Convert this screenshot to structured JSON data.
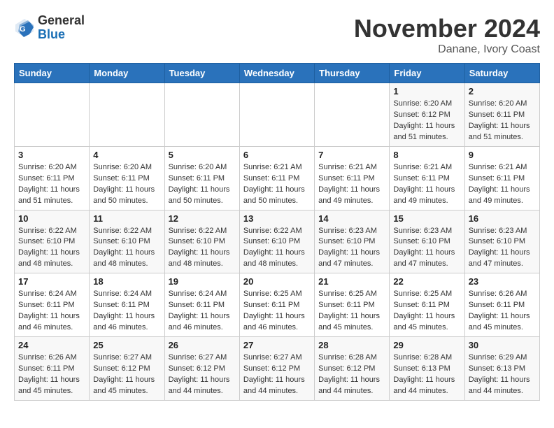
{
  "header": {
    "logo_line1": "General",
    "logo_line2": "Blue",
    "month": "November 2024",
    "location": "Danane, Ivory Coast"
  },
  "weekdays": [
    "Sunday",
    "Monday",
    "Tuesday",
    "Wednesday",
    "Thursday",
    "Friday",
    "Saturday"
  ],
  "weeks": [
    [
      {
        "day": "",
        "info": ""
      },
      {
        "day": "",
        "info": ""
      },
      {
        "day": "",
        "info": ""
      },
      {
        "day": "",
        "info": ""
      },
      {
        "day": "",
        "info": ""
      },
      {
        "day": "1",
        "info": "Sunrise: 6:20 AM\nSunset: 6:12 PM\nDaylight: 11 hours\nand 51 minutes."
      },
      {
        "day": "2",
        "info": "Sunrise: 6:20 AM\nSunset: 6:11 PM\nDaylight: 11 hours\nand 51 minutes."
      }
    ],
    [
      {
        "day": "3",
        "info": "Sunrise: 6:20 AM\nSunset: 6:11 PM\nDaylight: 11 hours\nand 51 minutes."
      },
      {
        "day": "4",
        "info": "Sunrise: 6:20 AM\nSunset: 6:11 PM\nDaylight: 11 hours\nand 50 minutes."
      },
      {
        "day": "5",
        "info": "Sunrise: 6:20 AM\nSunset: 6:11 PM\nDaylight: 11 hours\nand 50 minutes."
      },
      {
        "day": "6",
        "info": "Sunrise: 6:21 AM\nSunset: 6:11 PM\nDaylight: 11 hours\nand 50 minutes."
      },
      {
        "day": "7",
        "info": "Sunrise: 6:21 AM\nSunset: 6:11 PM\nDaylight: 11 hours\nand 49 minutes."
      },
      {
        "day": "8",
        "info": "Sunrise: 6:21 AM\nSunset: 6:11 PM\nDaylight: 11 hours\nand 49 minutes."
      },
      {
        "day": "9",
        "info": "Sunrise: 6:21 AM\nSunset: 6:11 PM\nDaylight: 11 hours\nand 49 minutes."
      }
    ],
    [
      {
        "day": "10",
        "info": "Sunrise: 6:22 AM\nSunset: 6:10 PM\nDaylight: 11 hours\nand 48 minutes."
      },
      {
        "day": "11",
        "info": "Sunrise: 6:22 AM\nSunset: 6:10 PM\nDaylight: 11 hours\nand 48 minutes."
      },
      {
        "day": "12",
        "info": "Sunrise: 6:22 AM\nSunset: 6:10 PM\nDaylight: 11 hours\nand 48 minutes."
      },
      {
        "day": "13",
        "info": "Sunrise: 6:22 AM\nSunset: 6:10 PM\nDaylight: 11 hours\nand 48 minutes."
      },
      {
        "day": "14",
        "info": "Sunrise: 6:23 AM\nSunset: 6:10 PM\nDaylight: 11 hours\nand 47 minutes."
      },
      {
        "day": "15",
        "info": "Sunrise: 6:23 AM\nSunset: 6:10 PM\nDaylight: 11 hours\nand 47 minutes."
      },
      {
        "day": "16",
        "info": "Sunrise: 6:23 AM\nSunset: 6:10 PM\nDaylight: 11 hours\nand 47 minutes."
      }
    ],
    [
      {
        "day": "17",
        "info": "Sunrise: 6:24 AM\nSunset: 6:11 PM\nDaylight: 11 hours\nand 46 minutes."
      },
      {
        "day": "18",
        "info": "Sunrise: 6:24 AM\nSunset: 6:11 PM\nDaylight: 11 hours\nand 46 minutes."
      },
      {
        "day": "19",
        "info": "Sunrise: 6:24 AM\nSunset: 6:11 PM\nDaylight: 11 hours\nand 46 minutes."
      },
      {
        "day": "20",
        "info": "Sunrise: 6:25 AM\nSunset: 6:11 PM\nDaylight: 11 hours\nand 46 minutes."
      },
      {
        "day": "21",
        "info": "Sunrise: 6:25 AM\nSunset: 6:11 PM\nDaylight: 11 hours\nand 45 minutes."
      },
      {
        "day": "22",
        "info": "Sunrise: 6:25 AM\nSunset: 6:11 PM\nDaylight: 11 hours\nand 45 minutes."
      },
      {
        "day": "23",
        "info": "Sunrise: 6:26 AM\nSunset: 6:11 PM\nDaylight: 11 hours\nand 45 minutes."
      }
    ],
    [
      {
        "day": "24",
        "info": "Sunrise: 6:26 AM\nSunset: 6:11 PM\nDaylight: 11 hours\nand 45 minutes."
      },
      {
        "day": "25",
        "info": "Sunrise: 6:27 AM\nSunset: 6:12 PM\nDaylight: 11 hours\nand 45 minutes."
      },
      {
        "day": "26",
        "info": "Sunrise: 6:27 AM\nSunset: 6:12 PM\nDaylight: 11 hours\nand 44 minutes."
      },
      {
        "day": "27",
        "info": "Sunrise: 6:27 AM\nSunset: 6:12 PM\nDaylight: 11 hours\nand 44 minutes."
      },
      {
        "day": "28",
        "info": "Sunrise: 6:28 AM\nSunset: 6:12 PM\nDaylight: 11 hours\nand 44 minutes."
      },
      {
        "day": "29",
        "info": "Sunrise: 6:28 AM\nSunset: 6:13 PM\nDaylight: 11 hours\nand 44 minutes."
      },
      {
        "day": "30",
        "info": "Sunrise: 6:29 AM\nSunset: 6:13 PM\nDaylight: 11 hours\nand 44 minutes."
      }
    ]
  ]
}
